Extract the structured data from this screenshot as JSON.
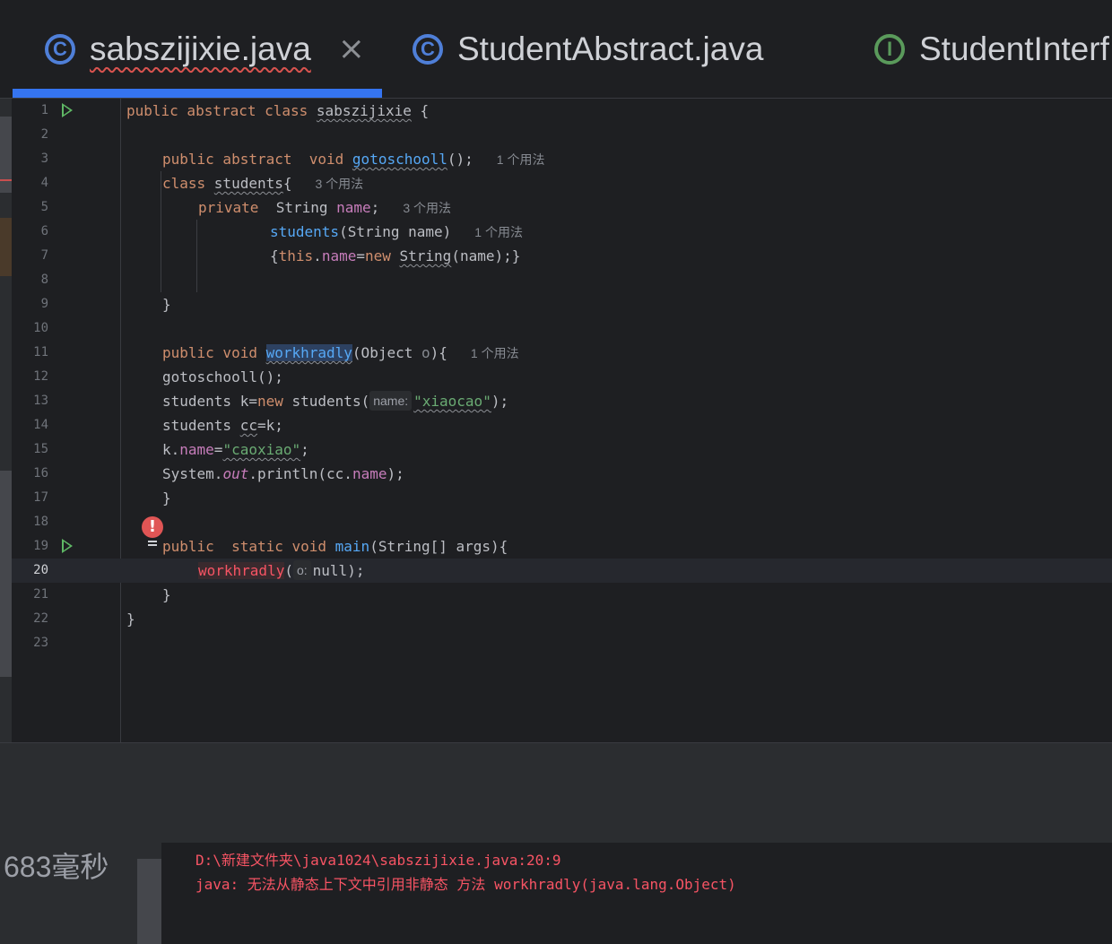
{
  "tabs": [
    {
      "label": "sabszijixie.java",
      "icon": "class-icon",
      "icon_glyph": "C",
      "active": true,
      "has_error": true,
      "close": "×"
    },
    {
      "label": "StudentAbstract.java",
      "icon": "class-icon",
      "icon_glyph": "C"
    },
    {
      "label": "StudentInterf",
      "icon": "interface-icon",
      "icon_glyph": "I"
    }
  ],
  "editor": {
    "line_numbers": [
      "1",
      "2",
      "3",
      "4",
      "5",
      "6",
      "7",
      "8",
      "9",
      "10",
      "11",
      "12",
      "13",
      "14",
      "15",
      "16",
      "17",
      "18",
      "19",
      "20",
      "21",
      "22",
      "23"
    ],
    "current_line": "20",
    "lines": {
      "l1": {
        "a": "public abstract class ",
        "b": "sabszijixie",
        "c": " {"
      },
      "l3": {
        "a": "public abstract  void ",
        "b": "gotoschooll",
        "c": "();",
        "hint": "1 个用法"
      },
      "l4": {
        "a": "class ",
        "b": "students",
        "c": "{",
        "hint": "3 个用法"
      },
      "l5": {
        "a": "private  ",
        "b": "String ",
        "c": "name",
        "d": ";",
        "hint": "3 个用法"
      },
      "l6": {
        "a": "students",
        "b": "(String name)",
        "hint": "1 个用法"
      },
      "l7": {
        "a": "{",
        "b": "this",
        "c": ".",
        "d": "name",
        "e": "=",
        "f": "new ",
        "g": "String",
        "h": "(name);}"
      },
      "l9": {
        "a": "}"
      },
      "l11": {
        "a": "public void ",
        "b": "workhradly",
        "c": "(Object ",
        "d": "o",
        "e": "){",
        "hint": "1 个用法"
      },
      "l12": {
        "a": "gotoschooll();"
      },
      "l13": {
        "a": "students k=",
        "b": "new",
        "c": " students(",
        "inlay": "name:",
        "d": "\"xiaocao\"",
        "e": ");"
      },
      "l14": {
        "a": "students ",
        "b": "cc",
        "c": "=k;"
      },
      "l15": {
        "a": "k.",
        "b": "name",
        "c": "=",
        "d": "\"caoxiao\"",
        "e": ";"
      },
      "l16": {
        "a": "System.",
        "b": "out",
        "c": ".println(cc.",
        "d": "name",
        "e": ");"
      },
      "l17": {
        "a": "}"
      },
      "l19": {
        "a": "public  static void ",
        "b": "main",
        "c": "(String[] args){"
      },
      "l20": {
        "a": "workhradly",
        "b": "(",
        "inlay": "o:",
        "c": "null);"
      },
      "l21": {
        "a": "}"
      },
      "l22": {
        "a": "}"
      }
    }
  },
  "console": {
    "elapsed": "683毫秒",
    "error_path": "D:\\新建文件夹\\java1024\\sabszijixie.java:20:9",
    "error_message": "java: 无法从静态上下文中引用非静态 方法 workhradly(java.lang.Object)"
  },
  "colors": {
    "accent": "#3574f0",
    "keyword": "#cf8e6d",
    "error": "#f75464",
    "string": "#6aab73",
    "function": "#56a8f5",
    "field": "#c77dbb"
  }
}
